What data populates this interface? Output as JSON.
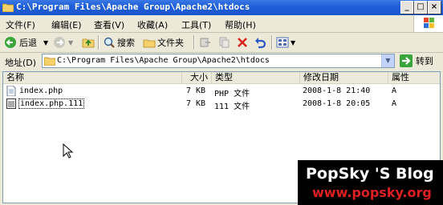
{
  "window": {
    "title": "C:\\Program Files\\Apache Group\\Apache2\\htdocs"
  },
  "menu": [
    "文件(F)",
    "编辑(E)",
    "查看(V)",
    "收藏(A)",
    "工具(T)",
    "帮助(H)"
  ],
  "toolbar": {
    "back": "后退",
    "search": "搜索",
    "folders": "文件夹"
  },
  "address": {
    "label": "地址(D)",
    "value": "C:\\Program Files\\Apache Group\\Apache2\\htdocs",
    "go": "转到"
  },
  "columns": {
    "name": "名称",
    "size": "大小",
    "type": "类型",
    "modified": "修改日期",
    "attr": "属性"
  },
  "files": [
    {
      "name": "index.php",
      "size": "7 KB",
      "type": "PHP 文件",
      "modified": "2008-1-8 21:40",
      "attr": "A"
    },
    {
      "name": "index.php.111",
      "size": "7 KB",
      "type": "111 文件",
      "modified": "2008-1-8 20:05",
      "attr": "A"
    }
  ],
  "watermark": {
    "line1": "PopSky 'S Blog",
    "line2": "www.popsky.org"
  },
  "colors": {
    "titlebar": "#1f5fd9",
    "chrome": "#ece9d8",
    "watermark_red": "#e02020"
  }
}
